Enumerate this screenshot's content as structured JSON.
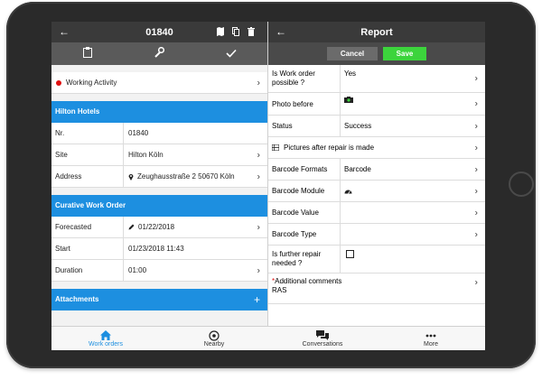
{
  "left": {
    "header": {
      "title": "01840"
    },
    "activity": {
      "label": "Working Activity"
    },
    "hotel_section": {
      "title": "Hilton Hotels"
    },
    "fields": [
      {
        "key": "Nr.",
        "value": "01840"
      },
      {
        "key": "Site",
        "value": "Hilton Köln"
      },
      {
        "key": "Address",
        "value": "Zeughausstraße 2 50670 Köln"
      }
    ],
    "work_section": {
      "title": "Curative Work Order"
    },
    "work_fields": [
      {
        "key": "Forecasted",
        "value": "01/22/2018"
      },
      {
        "key": "Start",
        "value": "01/23/2018 11:43"
      },
      {
        "key": "Duration",
        "value": "01:00"
      }
    ],
    "attachments": {
      "title": "Attachments"
    }
  },
  "right": {
    "header": {
      "title": "Report"
    },
    "cancel_label": "Cancel",
    "save_label": "Save",
    "rows": [
      {
        "key": "Is Work order possible ?",
        "value": "Yes"
      },
      {
        "key": "Photo before",
        "value": ""
      },
      {
        "key": "Status",
        "value": "Success"
      },
      {
        "key": "Pictures after repair is made",
        "value": ""
      },
      {
        "key": "Barcode Formats",
        "value": "Barcode"
      },
      {
        "key": "Barcode Module",
        "value": ""
      },
      {
        "key": "Barcode Value",
        "value": ""
      },
      {
        "key": "Barcode Type",
        "value": ""
      },
      {
        "key": "Is further repair needed ?",
        "value": ""
      }
    ],
    "comments": {
      "required_mark": "*",
      "label": "Additional comments",
      "value": "RAS"
    }
  },
  "nav": [
    {
      "label": "Work orders",
      "icon": "home-icon"
    },
    {
      "label": "Nearby",
      "icon": "location-target-icon"
    },
    {
      "label": "Conversations",
      "icon": "chat-bubbles-icon"
    },
    {
      "label": "More",
      "icon": "more-dots-icon"
    }
  ],
  "colors": {
    "accent": "#1d8fe0",
    "save": "#3cd43c",
    "header": "#3a3a3a",
    "status_dot": "#e01010"
  }
}
